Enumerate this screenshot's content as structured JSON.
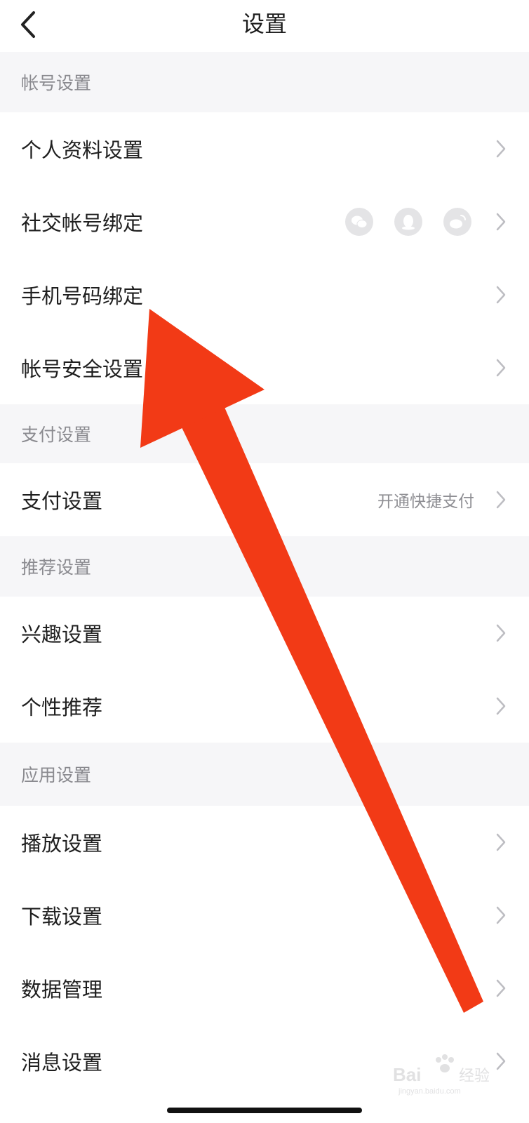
{
  "nav": {
    "title": "设置",
    "back_icon": "chevron-left-icon"
  },
  "sections": [
    {
      "header": "帐号设置",
      "rows": [
        {
          "label": "个人资料设置"
        },
        {
          "label": "社交帐号绑定",
          "social_icons": [
            "wechat-icon",
            "qq-icon",
            "weibo-icon"
          ]
        },
        {
          "label": "手机号码绑定"
        },
        {
          "label": "帐号安全设置"
        }
      ]
    },
    {
      "header": "支付设置",
      "rows": [
        {
          "label": "支付设置",
          "value": "开通快捷支付"
        }
      ]
    },
    {
      "header": "推荐设置",
      "rows": [
        {
          "label": "兴趣设置"
        },
        {
          "label": "个性推荐"
        }
      ]
    },
    {
      "header": "应用设置",
      "rows": [
        {
          "label": "播放设置"
        },
        {
          "label": "下载设置"
        },
        {
          "label": "数据管理"
        },
        {
          "label": "消息设置"
        }
      ]
    }
  ],
  "annotation": {
    "arrow_color": "#f23a16",
    "points_to": "手机号码绑定"
  },
  "watermark": {
    "text": "Bai du 经验",
    "subtext": "jingyan.baidu.com"
  },
  "colors": {
    "section_bg": "#f6f6f8",
    "row_bg": "#ffffff",
    "secondary_text": "#8e8e93"
  }
}
